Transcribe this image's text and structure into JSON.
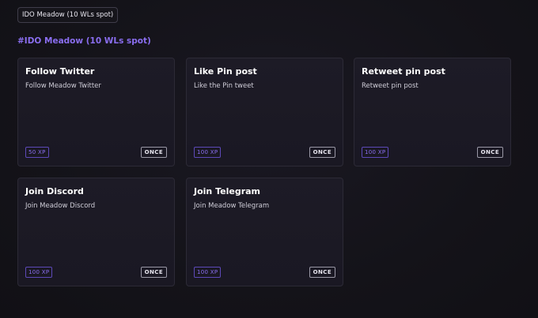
{
  "header": {
    "chip_label": "IDO Meadow (10 WLs spot)",
    "section_title": "#IDO Meadow (10 WLs spot)"
  },
  "colors": {
    "accent": "#8a6ef0",
    "background": "#131218",
    "card": "#1c1a25"
  },
  "tasks": [
    {
      "title": "Follow Twitter",
      "description": "Follow Meadow Twitter",
      "xp": "50 XP",
      "frequency": "ONCE"
    },
    {
      "title": "Like Pin post",
      "description": "Like the Pin tweet",
      "xp": "100 XP",
      "frequency": "ONCE"
    },
    {
      "title": "Retweet pin post",
      "description": "Retweet pin post",
      "xp": "100 XP",
      "frequency": "ONCE"
    },
    {
      "title": "Join Discord",
      "description": "Join Meadow Discord",
      "xp": "100 XP",
      "frequency": "ONCE"
    },
    {
      "title": "Join Telegram",
      "description": "Join Meadow Telegram",
      "xp": "100 XP",
      "frequency": "ONCE"
    }
  ]
}
